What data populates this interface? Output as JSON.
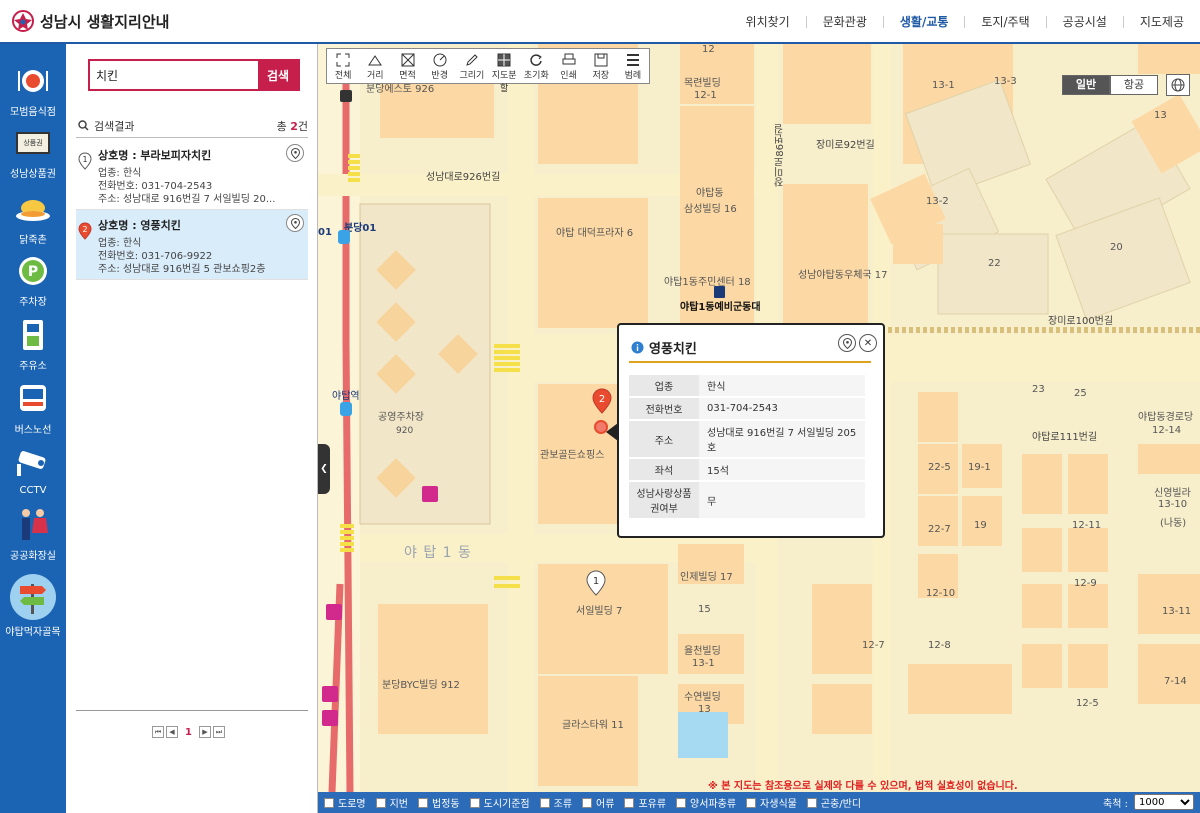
{
  "header": {
    "title": "성남시 생활지리안내",
    "menu": [
      "위치찾기",
      "문화관광",
      "생활/교통",
      "토지/주택",
      "공공시설",
      "지도제공"
    ],
    "active_menu": "생활/교통"
  },
  "sidebar": {
    "items": [
      {
        "label": "모범음식점",
        "icon": "restaurant-icon"
      },
      {
        "label": "성남상품권",
        "icon": "gift-card-icon"
      },
      {
        "label": "닭죽촌",
        "icon": "chicken-dish-icon"
      },
      {
        "label": "주차장",
        "icon": "parking-icon"
      },
      {
        "label": "주유소",
        "icon": "gas-station-icon"
      },
      {
        "label": "버스노선",
        "icon": "bus-icon"
      },
      {
        "label": "CCTV",
        "icon": "cctv-icon"
      },
      {
        "label": "공공화장실",
        "icon": "restroom-icon"
      },
      {
        "label": "야탑먹자골목",
        "icon": "signpost-icon"
      }
    ],
    "active": "야탑먹자골목",
    "gift_card_badge": "상품권"
  },
  "search": {
    "value": "치킨",
    "button": "검색",
    "results_label": "검색결과",
    "total_prefix": "총 ",
    "total_count": "2",
    "total_suffix": "건"
  },
  "results": [
    {
      "num": "1",
      "name": "상호명 : 부라보피자치킨",
      "type": "업종: 한식",
      "phone": "전화번호: 031-704-2543",
      "address": "주소: 성남대로 916번길 7 서일빌딩 20..."
    },
    {
      "num": "2",
      "name": "상호명 : 영풍치킨",
      "type": "업종: 한식",
      "phone": "전화번호: 031-706-9922",
      "address": "주소: 성남대로 916번길 5 관보쇼핑2층"
    }
  ],
  "pager": {
    "current": "1"
  },
  "toolbar": [
    "전체",
    "거리",
    "면적",
    "반경",
    "그리기",
    "지도분할",
    "초기화",
    "인쇄",
    "저장",
    "범례"
  ],
  "map_type": {
    "options": [
      "일반",
      "항공"
    ],
    "selected": "일반"
  },
  "popup": {
    "title": "영풍치킨",
    "rows": [
      {
        "k": "업종",
        "v": "한식"
      },
      {
        "k": "전화번호",
        "v": "031-704-2543"
      },
      {
        "k": "주소",
        "v": "성남대로 916번길 7 서일빌딩 205호"
      },
      {
        "k": "좌석",
        "v": "15석"
      },
      {
        "k": "성남사랑상품권여부",
        "v": "무"
      }
    ]
  },
  "map_labels": {
    "road1": "성남대로926번길",
    "road2": "장미로92번길",
    "road3": "장미로100번길",
    "road4": "야탑로111번길",
    "road5": "장미로86번길",
    "station": "분당01",
    "station_id": "01",
    "yatap_station": "야탑역",
    "parking": "공영주차장",
    "parking_no": "920",
    "dong": "야 탑 1 동",
    "b1": "분당에스토 926",
    "b2": "목련빌딩",
    "b2n": "12-1",
    "b3": "야탑 대덕프라자 6",
    "b4": "야탑동",
    "b4b": "삼성빌딩 16",
    "b5": "야탑1동주민센터 18",
    "b6": "야탑1동예비군동대",
    "b7": "성남야탑동우체국 17",
    "b8": "관보골든쇼핑스",
    "b9": "서일빌딩 7",
    "b10": "인제빌딩 17",
    "b11": "15",
    "b12": "율천빌딩",
    "b12n": "13-1",
    "b13": "수연빌딩",
    "b13n": "13",
    "b14": "글라스타워 11",
    "b15": "분당BYC빌딩 912",
    "b16": "야탑동경로당",
    "b16n": "12-14",
    "b17": "신영빌라",
    "b17n": "13-10",
    "b17d": "(나동)",
    "n12": "12",
    "n131": "13-1",
    "n133": "13-3",
    "n13": "13",
    "n132": "13-2",
    "n20": "20",
    "n22": "22",
    "n23": "23",
    "n25": "25",
    "n225": "22-5",
    "n191": "19-1",
    "n227": "22-7",
    "n19": "19",
    "n1211": "12-11",
    "n1210": "12-10",
    "n129": "12-9",
    "n127": "12-7",
    "n128": "12-8",
    "n125": "12-5",
    "n1311": "13-11",
    "n714": "7-14",
    "marker1": "1",
    "marker2": "2"
  },
  "notice": "※ 본 지도는 참조용으로 실제와 다를 수 있으며, 법적 실효성이 없습니다.",
  "legend": [
    "도로명",
    "지번",
    "법정동",
    "도시기준점",
    "조류",
    "어류",
    "포유류",
    "양서파충류",
    "자생식물",
    "곤충/반디"
  ],
  "scale": {
    "label": "축척 :",
    "value": "1000"
  },
  "colors": {
    "brand": "#1b63b3",
    "accent": "#c71f4c",
    "highlight": "#d9ecfa",
    "map_bg": "#f7eecb",
    "building": "#fcd9a4"
  }
}
